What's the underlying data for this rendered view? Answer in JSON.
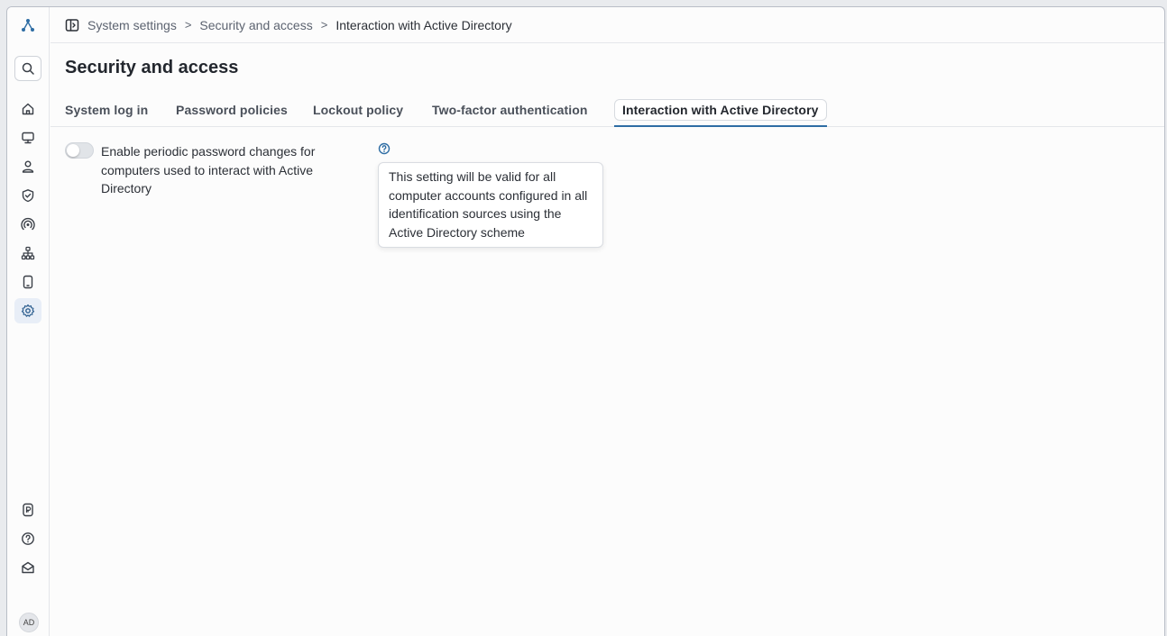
{
  "rail": {
    "top_icons": [
      "logo-icon",
      "search-icon",
      "home-icon",
      "monitor-icon",
      "user-icon",
      "shield-check-icon",
      "broadcast-icon",
      "network-icon",
      "mobile-icon",
      "settings-icon"
    ],
    "bottom_icons": [
      "license-icon",
      "help-icon",
      "inbox-icon"
    ],
    "avatar_initials": "AD",
    "active": "settings-icon"
  },
  "breadcrumb": {
    "items": [
      "System settings",
      "Security and access",
      "Interaction with Active Directory"
    ]
  },
  "page": {
    "title": "Security and access"
  },
  "tabs": [
    {
      "label": "System log in",
      "active": false
    },
    {
      "label": "Password policies",
      "active": false
    },
    {
      "label": "Lockout policy",
      "active": false
    },
    {
      "label": "Two-factor authentication",
      "active": false
    },
    {
      "label": "Interaction with Active Directory",
      "active": true
    }
  ],
  "setting": {
    "label": "Enable periodic password changes for computers used to interact with Active Directory",
    "enabled": false,
    "tooltip": "This setting will be valid for all computer accounts configured in all identification sources using the Active Directory scheme"
  },
  "colors": {
    "accent": "#2e6da4",
    "active_rail_bg": "#e8eef7"
  }
}
